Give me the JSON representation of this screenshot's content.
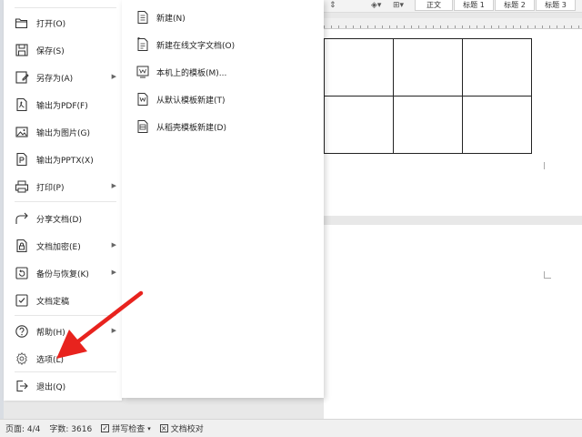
{
  "toolbar": {
    "styles": [
      "正文",
      "标题 1",
      "标题 2",
      "标题 3"
    ],
    "icons": [
      "paragraph-spacing-icon",
      "fill-color-icon",
      "border-icon"
    ]
  },
  "file_menu": {
    "items": [
      {
        "label": "打开(O)",
        "icon": "folder-open-icon",
        "has_submenu": false
      },
      {
        "label": "保存(S)",
        "icon": "save-icon",
        "has_submenu": false
      },
      {
        "label": "另存为(A)",
        "icon": "save-as-icon",
        "has_submenu": true
      },
      {
        "label": "输出为PDF(F)",
        "icon": "export-pdf-icon",
        "has_submenu": false
      },
      {
        "label": "输出为图片(G)",
        "icon": "export-image-icon",
        "has_submenu": false
      },
      {
        "label": "输出为PPTX(X)",
        "icon": "export-pptx-icon",
        "has_submenu": false
      },
      {
        "label": "打印(P)",
        "icon": "print-icon",
        "has_submenu": true
      },
      {
        "label": "分享文档(D)",
        "icon": "share-icon",
        "has_submenu": false
      },
      {
        "label": "文档加密(E)",
        "icon": "encrypt-icon",
        "has_submenu": true
      },
      {
        "label": "备份与恢复(K)",
        "icon": "backup-icon",
        "has_submenu": true
      },
      {
        "label": "文档定稿",
        "icon": "finalize-icon",
        "has_submenu": false
      },
      {
        "label": "帮助(H)",
        "icon": "help-icon",
        "has_submenu": true
      },
      {
        "label": "选项(L)",
        "icon": "settings-icon",
        "has_submenu": false
      },
      {
        "label": "退出(Q)",
        "icon": "exit-icon",
        "has_submenu": false
      }
    ]
  },
  "new_submenu": {
    "items": [
      {
        "label": "新建(N)",
        "icon": "new-document-icon"
      },
      {
        "label": "新建在线文字文档(O)",
        "icon": "new-online-document-icon"
      },
      {
        "label": "本机上的模板(M)...",
        "icon": "local-template-icon"
      },
      {
        "label": "从默认模板新建(T)",
        "icon": "default-template-icon"
      },
      {
        "label": "从稻壳模板新建(D)",
        "icon": "docer-template-icon"
      }
    ]
  },
  "status_bar": {
    "page": "页面: 4/4",
    "word_count": "字数: 3616",
    "spell_check": "拼写检查",
    "proofread": "文档校对"
  },
  "colors": {
    "annotation_arrow": "#e8231e",
    "menu_background": "#ffffff",
    "workspace_background": "#e8e8e8"
  }
}
